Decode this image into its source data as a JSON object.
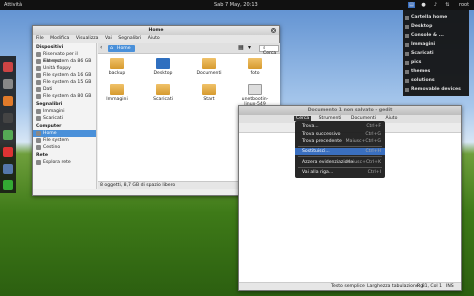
{
  "topbar": {
    "activities": "Attività",
    "clock": "Sab 7 May, 20:13",
    "user": "root"
  },
  "files_window": {
    "title": "Home",
    "menu": [
      "File",
      "Modifica",
      "Visualizza",
      "Vai",
      "Segnalibri",
      "Aiuto"
    ],
    "sidebar": {
      "devices_header": "Dispositivi",
      "devices": [
        "Riservato per il sistema",
        "File system da 86 GB",
        "Unità floppy",
        "File system da 16 GB",
        "File system da 15 GB",
        "Dati",
        "File system da 80 GB"
      ],
      "bookmarks_header": "Segnalibri",
      "bookmarks": [
        "Immagini",
        "Scaricati"
      ],
      "computer_header": "Computer",
      "computer": [
        "Home",
        "File system",
        "Cestino"
      ],
      "network_header": "Rete",
      "network": [
        "Esplora rete"
      ]
    },
    "breadcrumb": "Home",
    "search_label": "Cerca",
    "files": [
      "backup",
      "Desktop",
      "Documenti",
      "foto",
      "Immagini",
      "Scaricati",
      "Start",
      "unetbootin-linux-549"
    ],
    "status": "8 oggetti, 8,7 GB di spazio libero"
  },
  "editor_window": {
    "title": "Documento 1 non salvato - gedit",
    "menu": [
      "Cerca",
      "Strumenti",
      "Documenti",
      "Aiuto"
    ],
    "status": [
      "Testo semplice",
      "Larghezza tabulazione: 8",
      "Rg 1, Col 1",
      "INS"
    ]
  },
  "search_menu": [
    {
      "label": "Trova...",
      "shortcut": "Ctrl+F"
    },
    {
      "label": "Trova successivo",
      "shortcut": "Ctrl+G"
    },
    {
      "label": "Trova precedente",
      "shortcut": "Maiusc+Ctrl+G"
    },
    {
      "label": "Sostituisci...",
      "shortcut": "Ctrl+H"
    },
    {
      "label": "Azzera evidenziazione",
      "shortcut": "Maiusc+Ctrl+K"
    },
    {
      "label": "Vai alla riga...",
      "shortcut": "Ctrl+I"
    }
  ],
  "panel_menu": [
    "Cartella home",
    "Desktop",
    "Console & ...",
    "Immagini",
    "Scaricati",
    "pics",
    "themes",
    "solutions",
    "Removable devices"
  ],
  "colors": {
    "accent": "#4a90d9",
    "topbar": "#111111"
  }
}
